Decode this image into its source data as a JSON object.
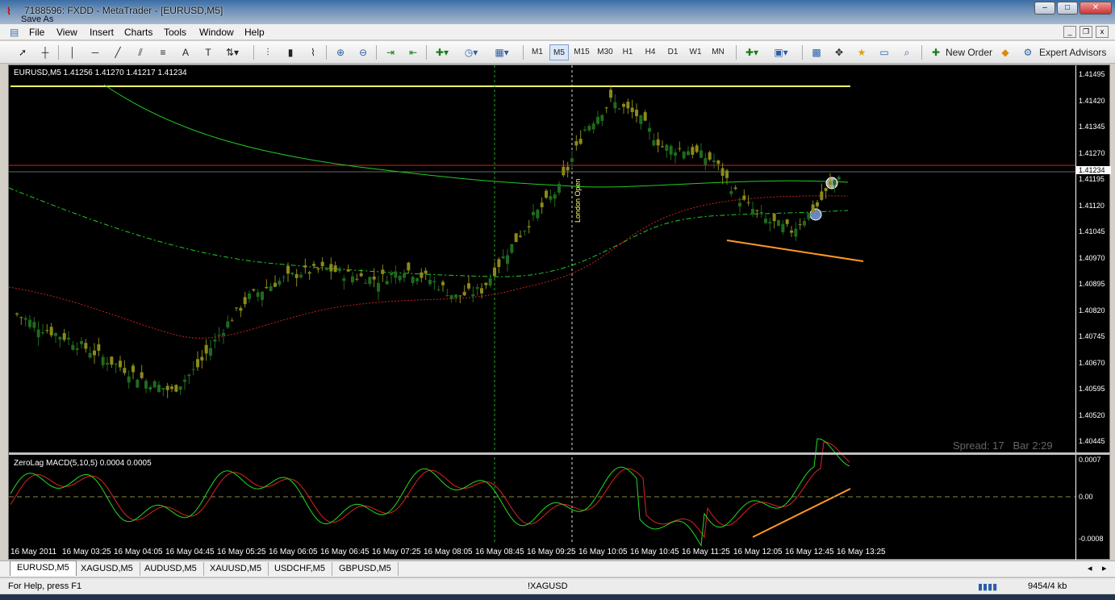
{
  "window": {
    "title": "7188596: FXDD - MetaTrader - [EURUSD,M5]",
    "ghost_title": "Save As",
    "buttons": [
      "–",
      "□",
      "✕"
    ]
  },
  "menu": [
    "File",
    "View",
    "Insert",
    "Charts",
    "Tools",
    "Window",
    "Help"
  ],
  "toolbar": {
    "timeframes": [
      "M1",
      "M5",
      "M15",
      "M30",
      "H1",
      "H4",
      "D1",
      "W1",
      "MN"
    ],
    "active_timeframe": "M5",
    "new_order_label": "New Order",
    "expert_advisors_label": "Expert Advisors"
  },
  "chart": {
    "header": "EURUSD,M5  1.41256 1.41270 1.41217 1.41234",
    "macd_header": "ZeroLag MACD(5,10,5) 0.0004 0.0005",
    "london_open_label": "London Open",
    "spread_label": "Spread: 17",
    "bar_label": "Bar  2:29",
    "price_labels": [
      "1.41495",
      "1.41420",
      "1.41345",
      "1.41270",
      "1.41234",
      "1.41195",
      "1.41120",
      "1.41045",
      "1.40970",
      "1.40895",
      "1.40820",
      "1.40745",
      "1.40670",
      "1.40595",
      "1.40520",
      "1.40445"
    ],
    "macd_labels": [
      "0.0007",
      "0.00",
      "-0.0008"
    ],
    "time_labels": [
      "16 May 2011",
      "16 May 03:25",
      "16 May 04:05",
      "16 May 04:45",
      "16 May 05:25",
      "16 May 06:05",
      "16 May 06:45",
      "16 May 07:25",
      "16 May 08:05",
      "16 May 08:45",
      "16 May 09:25",
      "16 May 10:05",
      "16 May 10:45",
      "16 May 11:25",
      "16 May 12:05",
      "16 May 12:45",
      "16 May 13:25"
    ],
    "colors": {
      "bull": "#1e6b1e",
      "bear": "#8a8a1a",
      "ma_green": "#22cc22",
      "ma_red": "#cc2222",
      "hline_yellow": "#ffff66",
      "hline_red": "#cc2222",
      "trend_orange": "#ff9922",
      "macd_main": "#22dd22",
      "macd_signal": "#dd2222",
      "bid_box": "#cc0000"
    }
  },
  "chart_data": {
    "type": "line",
    "series": [
      {
        "values": [
          1.4081,
          1.4077,
          1.4074,
          1.407,
          1.4066,
          1.4062,
          1.4059,
          1.4066,
          1.4077,
          1.4086,
          1.409,
          1.4093,
          1.4094,
          1.4092,
          1.4091,
          1.4094,
          1.4091,
          1.4086,
          1.4088,
          1.4099,
          1.4109,
          1.4117,
          1.4134,
          1.4142,
          1.4138,
          1.4129,
          1.4128,
          1.4125,
          1.4114,
          1.4108,
          1.4105,
          1.4112,
          1.4123
        ]
      }
    ],
    "x": [
      "16 May 2011",
      "",
      "16 May 03:25",
      "",
      "16 May 04:05",
      "",
      "16 May 04:45",
      "",
      "16 May 05:25",
      "",
      "16 May 06:05",
      "",
      "16 May 06:45",
      "",
      "16 May 07:25",
      "",
      "16 May 08:05",
      "",
      "16 May 08:45",
      "",
      "16 May 09:25",
      "",
      "16 May 10:05",
      "",
      "16 May 10:45",
      "",
      "16 May 11:25",
      "",
      "16 May 12:05",
      "",
      "16 May 12:45",
      "",
      "16 May 13:25"
    ],
    "ylim": [
      1.40445,
      1.41545
    ]
  },
  "tabs": [
    "EURUSD,M5",
    "XAGUSD,M5",
    "AUDUSD,M5",
    "XAUUSD,M5",
    "USDCHF,M5",
    "GBPUSD,M5"
  ],
  "status": {
    "help": "For Help, press F1",
    "symbol": "!XAGUSD",
    "traffic": "9454/4 kb"
  }
}
